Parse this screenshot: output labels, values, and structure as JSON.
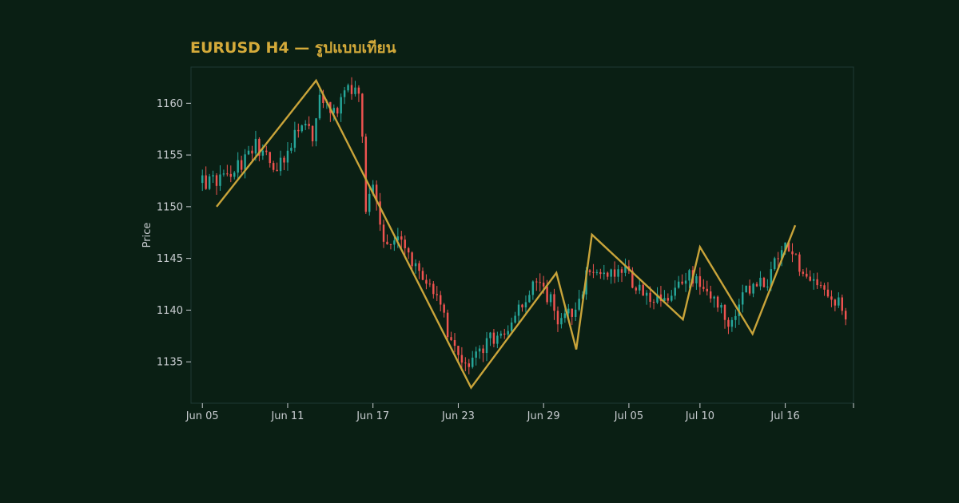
{
  "colors": {
    "background": "#0a1f14",
    "title": "#d4aa3a",
    "text": "#c8ccd0",
    "up": "#26a69a",
    "down": "#ef5350",
    "zigzag": "#c9a43a",
    "frame": "#1e3a34"
  },
  "chart_data": {
    "type": "candlestick",
    "title": "EURUSD H4 — รูปแบบเทียน",
    "xlabel": "",
    "ylabel": "Price",
    "ylim": [
      1131.0,
      1163.5
    ],
    "yticks": [
      1135,
      1140,
      1145,
      1150,
      1155,
      1160
    ],
    "xlim": [
      -0.8,
      45.8
    ],
    "xticks": [
      {
        "x": 0,
        "label": "Jun 05"
      },
      {
        "x": 6,
        "label": "Jun 11"
      },
      {
        "x": 12,
        "label": "Jun 17"
      },
      {
        "x": 18,
        "label": "Jun 23"
      },
      {
        "x": 24,
        "label": "Jun 29"
      },
      {
        "x": 30,
        "label": "Jul 05"
      },
      {
        "x": 35,
        "label": "Jul 10"
      },
      {
        "x": 41,
        "label": "Jul 16"
      }
    ],
    "grid": false,
    "anchors": [
      {
        "x": 0,
        "price": 1152.3
      },
      {
        "x": 2,
        "price": 1152.8
      },
      {
        "x": 4,
        "price": 1155.8
      },
      {
        "x": 5.5,
        "price": 1153.5
      },
      {
        "x": 7,
        "price": 1157.5
      },
      {
        "x": 8,
        "price": 1157.0
      },
      {
        "x": 8.5,
        "price": 1161.0
      },
      {
        "x": 9.3,
        "price": 1158.5
      },
      {
        "x": 10.5,
        "price": 1161.0
      },
      {
        "x": 11.4,
        "price": 1160.5
      },
      {
        "x": 11.7,
        "price": 1150.0
      },
      {
        "x": 12.3,
        "price": 1151.5
      },
      {
        "x": 13,
        "price": 1146.0
      },
      {
        "x": 14,
        "price": 1147.0
      },
      {
        "x": 15.5,
        "price": 1144.0
      },
      {
        "x": 17,
        "price": 1141.0
      },
      {
        "x": 17.5,
        "price": 1137.5
      },
      {
        "x": 18.5,
        "price": 1134.5
      },
      {
        "x": 20,
        "price": 1136.5
      },
      {
        "x": 22,
        "price": 1139.0
      },
      {
        "x": 23.5,
        "price": 1142.5
      },
      {
        "x": 24.5,
        "price": 1141.5
      },
      {
        "x": 25.5,
        "price": 1138.5
      },
      {
        "x": 26.5,
        "price": 1140.5
      },
      {
        "x": 27.5,
        "price": 1144.0
      },
      {
        "x": 28.5,
        "price": 1143.5
      },
      {
        "x": 30,
        "price": 1143.5
      },
      {
        "x": 31.5,
        "price": 1141.5
      },
      {
        "x": 32.5,
        "price": 1140.5
      },
      {
        "x": 33.5,
        "price": 1142.5
      },
      {
        "x": 35,
        "price": 1143.5
      },
      {
        "x": 36.5,
        "price": 1140.5
      },
      {
        "x": 37.3,
        "price": 1139.0
      },
      {
        "x": 38.5,
        "price": 1142.0
      },
      {
        "x": 40,
        "price": 1143.0
      },
      {
        "x": 41,
        "price": 1146.5
      },
      {
        "x": 42.5,
        "price": 1144.0
      },
      {
        "x": 44,
        "price": 1142.5
      },
      {
        "x": 45.4,
        "price": 1139.8
      }
    ],
    "zigzag": [
      {
        "x": 1.0,
        "y": 1150.0
      },
      {
        "x": 8.0,
        "y": 1162.2
      },
      {
        "x": 18.9,
        "y": 1132.5
      },
      {
        "x": 24.9,
        "y": 1143.6
      },
      {
        "x": 26.3,
        "y": 1136.2
      },
      {
        "x": 27.4,
        "y": 1147.3
      },
      {
        "x": 33.8,
        "y": 1139.1
      },
      {
        "x": 35.0,
        "y": 1146.1
      },
      {
        "x": 38.7,
        "y": 1137.7
      },
      {
        "x": 41.7,
        "y": 1148.2
      }
    ]
  }
}
